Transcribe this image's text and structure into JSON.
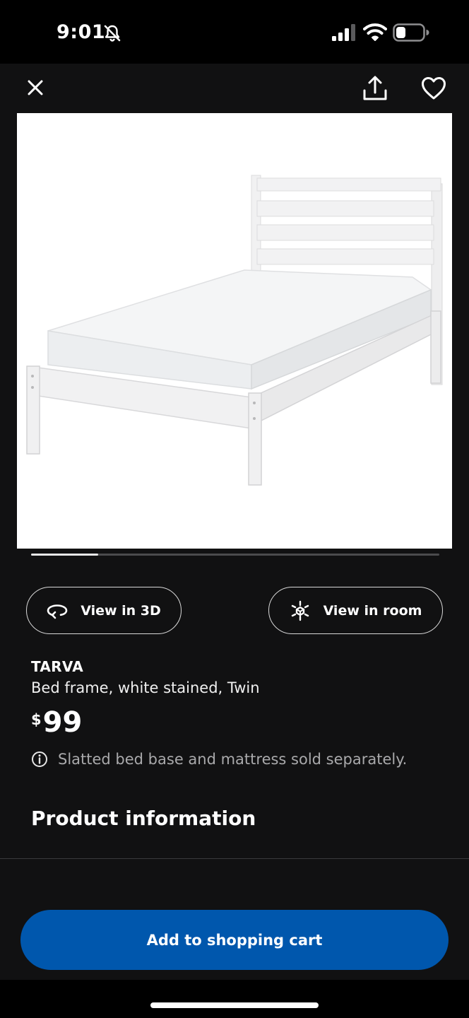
{
  "status_bar": {
    "time": "9:01",
    "icons": [
      "bell-slash-icon",
      "cellular-signal-icon",
      "wifi-icon",
      "battery-icon"
    ]
  },
  "nav": {
    "icons": [
      "close-icon",
      "share-icon",
      "heart-icon"
    ]
  },
  "gallery": {
    "image": "white bed frame with mattress",
    "progress": 0.165
  },
  "actions": {
    "view_3d_label": "View in 3D",
    "view_room_label": "View in room",
    "icons": [
      "rotate-3d-icon",
      "ar-cube-icon"
    ]
  },
  "product": {
    "name": "TARVA",
    "description": "Bed frame, white stained, Twin",
    "price_currency": "$",
    "price_amount": "99",
    "note": "Slatted bed base and mattress sold separately.",
    "note_icon": "info-icon"
  },
  "sections": {
    "product_information": "Product information"
  },
  "cta": {
    "label": "Add to shopping cart",
    "color": "#0057ad"
  }
}
